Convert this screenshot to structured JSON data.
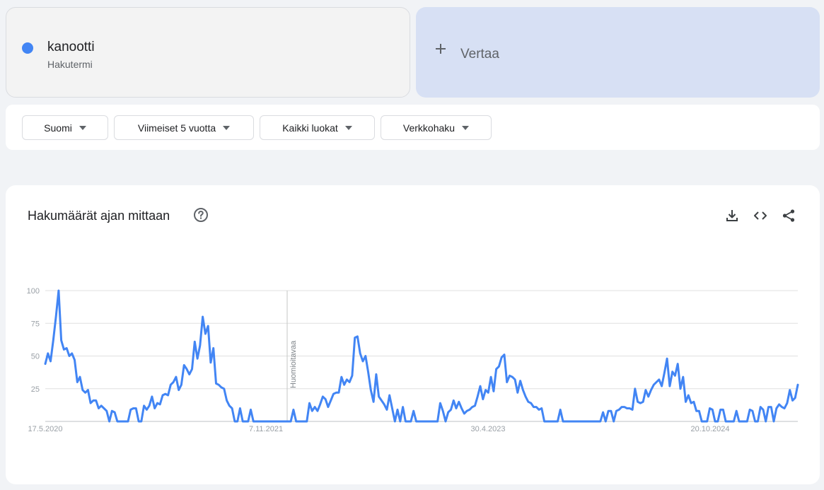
{
  "term": {
    "name": "kanootti",
    "type": "Hakutermi",
    "color": "#4285f4"
  },
  "compare": {
    "label": "Vertaa",
    "icon": "plus-icon"
  },
  "filters": [
    {
      "label": "Suomi"
    },
    {
      "label": "Viimeiset 5 vuotta"
    },
    {
      "label": "Kaikki luokat"
    },
    {
      "label": "Verkkohaku"
    }
  ],
  "chart_section": {
    "title": "Hakumäärät ajan mittaan",
    "icons": [
      "help-icon",
      "download-icon",
      "embed-code-icon",
      "share-icon"
    ]
  },
  "chart_data": {
    "type": "line",
    "title": "",
    "xlabel": "",
    "ylabel": "",
    "ylim": [
      0,
      100
    ],
    "y_ticks": [
      25,
      50,
      75,
      100
    ],
    "x_tick_labels": [
      "17.5.2020",
      "7.11.2021",
      "30.4.2023",
      "20.10.2024"
    ],
    "annotation": {
      "text": "Huomioitavaa",
      "near_x_label": "7.11.2021"
    },
    "grid": true,
    "series": [
      {
        "color": "#4285f4",
        "values": [
          44,
          52,
          46,
          62,
          80,
          100,
          62,
          55,
          56,
          50,
          52,
          47,
          30,
          34,
          24,
          22,
          24,
          14,
          16,
          16,
          10,
          12,
          10,
          8,
          0,
          8,
          7,
          0,
          0,
          0,
          0,
          0,
          9,
          10,
          10,
          0,
          0,
          12,
          9,
          12,
          19,
          10,
          14,
          13,
          20,
          21,
          20,
          28,
          30,
          34,
          24,
          28,
          43,
          40,
          36,
          40,
          61,
          48,
          58,
          80,
          67,
          73,
          45,
          56,
          29,
          28,
          26,
          25,
          16,
          12,
          10,
          0,
          0,
          10,
          0,
          0,
          0,
          9,
          0,
          0,
          0,
          0,
          0,
          0,
          0,
          0,
          0,
          0,
          0,
          0,
          0,
          0,
          0,
          9,
          0,
          0,
          0,
          0,
          0,
          14,
          8,
          11,
          8,
          13,
          19,
          17,
          11,
          16,
          21,
          22,
          22,
          34,
          28,
          32,
          30,
          35,
          64,
          65,
          52,
          46,
          50,
          38,
          24,
          15,
          36,
          19,
          16,
          13,
          9,
          20,
          10,
          0,
          9,
          0,
          11,
          0,
          0,
          0,
          8,
          0,
          0,
          0,
          0,
          0,
          0,
          0,
          0,
          0,
          14,
          8,
          0,
          7,
          9,
          16,
          10,
          15,
          10,
          6,
          8,
          9,
          11,
          12,
          19,
          27,
          17,
          24,
          22,
          34,
          23,
          40,
          42,
          49,
          51,
          30,
          35,
          34,
          32,
          22,
          31,
          24,
          19,
          15,
          14,
          11,
          11,
          9,
          10,
          0,
          0,
          0,
          0,
          0,
          0,
          9,
          0,
          0,
          0,
          0,
          0,
          0,
          0,
          0,
          0,
          0,
          0,
          0,
          0,
          0,
          0,
          7,
          0,
          8,
          8,
          0,
          8,
          9,
          11,
          11,
          10,
          10,
          9,
          25,
          15,
          14,
          15,
          24,
          19,
          24,
          28,
          30,
          32,
          27,
          37,
          48,
          27,
          38,
          35,
          44,
          25,
          34,
          15,
          20,
          14,
          15,
          8,
          8,
          0,
          0,
          0,
          10,
          9,
          0,
          0,
          9,
          9,
          0,
          0,
          0,
          0,
          8,
          0,
          0,
          0,
          0,
          9,
          8,
          0,
          0,
          11,
          9,
          0,
          11,
          11,
          0,
          10,
          13,
          11,
          10,
          14,
          24,
          16,
          18,
          28
        ]
      }
    ]
  }
}
